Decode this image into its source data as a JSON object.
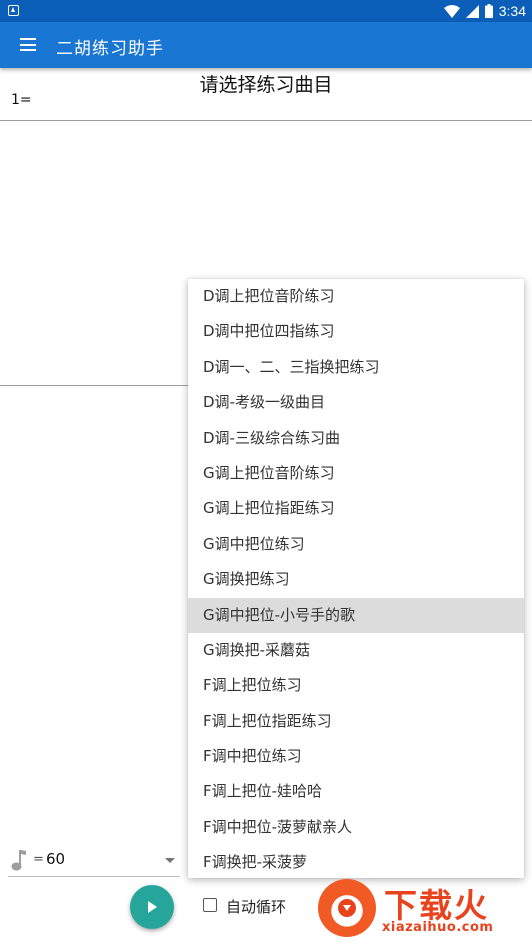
{
  "status_bar": {
    "time": "3:34",
    "icons": [
      "notification-icon",
      "wifi-icon",
      "signal-icon",
      "battery-icon"
    ]
  },
  "app_bar": {
    "title": "二胡练习助手",
    "menu_icon": "hamburger-menu-icon"
  },
  "score": {
    "title": "请选择练习曲目",
    "key_label": "1="
  },
  "dropdown": {
    "selected_index": 9,
    "items": [
      "D调上把位音阶练习",
      "D调中把位四指练习",
      "D调一、二、三指换把练习",
      "D调-考级一级曲目",
      "D调-三级综合练习曲",
      "G调上把位音阶练习",
      "G调上把位指距练习",
      "G调中把位练习",
      "G调换把练习",
      "G调中把位-小号手的歌",
      "G调换把-采蘑菇",
      "F调上把位练习",
      "F调上把位指距练习",
      "F调中把位练习",
      "F调上把位-娃哈哈",
      "F调中把位-菠萝献亲人",
      "F调换把-采菠萝"
    ]
  },
  "tempo": {
    "icon": "music-note-icon",
    "equals": "=",
    "value": "60"
  },
  "controls": {
    "play_icon": "play-icon",
    "auto_loop_label": "自动循环",
    "auto_loop_checked": false
  },
  "watermark": {
    "brand": "下载火",
    "domain": "xiazaihuo.com"
  },
  "colors": {
    "app_bar": "#1976d2",
    "status_bar": "#0b5fb8",
    "play_button": "#26a69a",
    "selected_item": "#dcdcdc",
    "watermark": "#e8431c"
  }
}
